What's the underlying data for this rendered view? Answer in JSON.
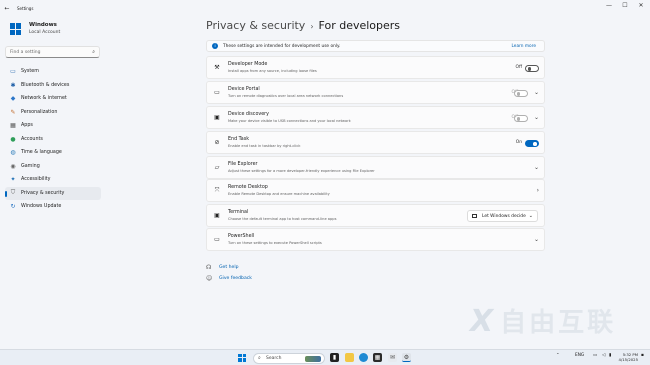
{
  "window": {
    "title": "Settings",
    "back": "←",
    "minimize": "—",
    "maximize": "☐",
    "close": "✕"
  },
  "user": {
    "name": "Windows",
    "account": "Local Account"
  },
  "search": {
    "placeholder": "Find a setting",
    "icon": "search-icon"
  },
  "nav": [
    {
      "label": "System",
      "icon": "monitor-icon",
      "glyph": "▭",
      "color": "#2b6cb0"
    },
    {
      "label": "Bluetooth & devices",
      "icon": "bluetooth-icon",
      "glyph": "✱",
      "color": "#1f5fa8"
    },
    {
      "label": "Network & internet",
      "icon": "wifi-icon",
      "glyph": "◆",
      "color": "#2d77c9"
    },
    {
      "label": "Personalization",
      "icon": "brush-icon",
      "glyph": "✎",
      "color": "#c06a2b"
    },
    {
      "label": "Apps",
      "icon": "apps-icon",
      "glyph": "▦",
      "color": "#555"
    },
    {
      "label": "Accounts",
      "icon": "person-icon",
      "glyph": "●",
      "color": "#2f9e5a"
    },
    {
      "label": "Time & language",
      "icon": "globe-icon",
      "glyph": "◍",
      "color": "#2b7bb9"
    },
    {
      "label": "Gaming",
      "icon": "gamepad-icon",
      "glyph": "◉",
      "color": "#666"
    },
    {
      "label": "Accessibility",
      "icon": "accessibility-icon",
      "glyph": "✦",
      "color": "#1e6fb5"
    },
    {
      "label": "Privacy & security",
      "icon": "shield-icon",
      "glyph": "⛉",
      "color": "#5a5a5a",
      "active": true
    },
    {
      "label": "Windows Update",
      "icon": "update-icon",
      "glyph": "↻",
      "color": "#1f6fc1"
    }
  ],
  "breadcrumb": {
    "parent": "Privacy & security",
    "separator": "›",
    "current": "For developers"
  },
  "info": {
    "text": "These settings are intended for development use only.",
    "link": "Learn more"
  },
  "cards": [
    {
      "id": "developer-mode",
      "title": "Developer Mode",
      "desc": "Install apps from any source, including loose files",
      "icon": "tools-icon",
      "glyph": "⚒",
      "state": "Off",
      "control": "toggle",
      "on": false,
      "disabled": false
    },
    {
      "id": "device-portal",
      "title": "Device Portal",
      "desc": "Turn on remote diagnostics over local area network connections",
      "icon": "portal-icon",
      "glyph": "▭",
      "state": "Off",
      "control": "toggle-expand",
      "on": false,
      "disabled": true
    },
    {
      "id": "device-discovery",
      "title": "Device discovery",
      "desc": "Make your device visible to USB connections and your local network",
      "icon": "discovery-icon",
      "glyph": "▣",
      "state": "Off",
      "control": "toggle-expand",
      "on": false,
      "disabled": true
    },
    {
      "id": "end-task",
      "title": "End Task",
      "desc": "Enable end task in taskbar by right-click",
      "icon": "end-task-icon",
      "glyph": "⊘",
      "state": "On",
      "control": "toggle",
      "on": true,
      "disabled": false
    },
    {
      "id": "file-explorer",
      "title": "File Explorer",
      "desc": "Adjust these settings for a more developer-friendly experience using File Explorer",
      "icon": "folder-icon",
      "glyph": "▱",
      "control": "expand"
    },
    {
      "id": "remote-desktop",
      "title": "Remote Desktop",
      "desc": "Enable Remote Desktop and ensure machine availability",
      "icon": "remote-desktop-icon",
      "glyph": "⤧",
      "control": "link"
    },
    {
      "id": "terminal",
      "title": "Terminal",
      "desc": "Choose the default terminal app to host command-line apps",
      "icon": "terminal-icon",
      "glyph": "▣",
      "control": "dropdown",
      "value": "Let Windows decide"
    },
    {
      "id": "powershell",
      "title": "PowerShell",
      "desc": "Turn on these settings to execute PowerShell scripts",
      "icon": "powershell-icon",
      "glyph": "▭",
      "control": "expand"
    }
  ],
  "help": {
    "get_help": "Get help",
    "give_feedback": "Give feedback"
  },
  "taskbar": {
    "search": "Search",
    "lang": "ENG",
    "time": "5:32 PM",
    "date": "4/15/2025"
  }
}
